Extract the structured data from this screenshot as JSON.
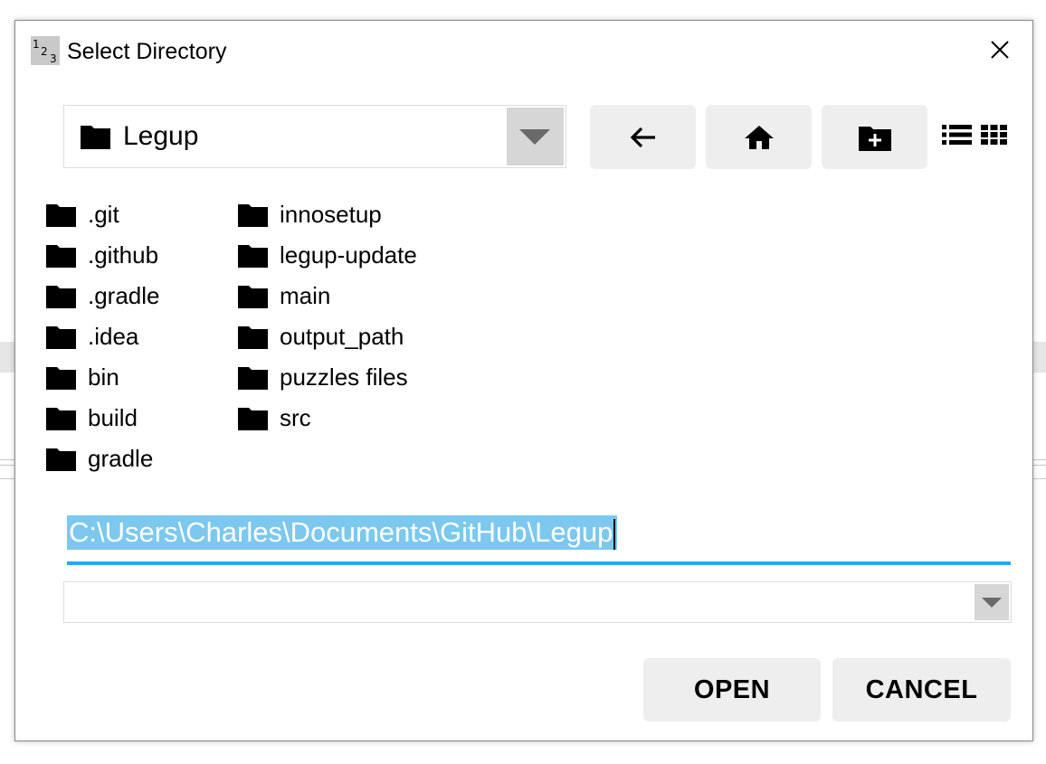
{
  "dialog": {
    "title": "Select Directory",
    "app_icon": "legup-123-icon",
    "close_icon": "close-icon"
  },
  "toolbar": {
    "current_directory": "Legup",
    "back_icon": "arrow-left-icon",
    "home_icon": "home-icon",
    "new_folder_icon": "new-folder-icon",
    "list_view_icon": "list-view-icon",
    "grid_view_icon": "grid-view-icon"
  },
  "folders": [
    ".git",
    ".github",
    ".gradle",
    ".idea",
    "bin",
    "build",
    "gradle",
    "innosetup",
    "legup-update",
    "main",
    "output_path",
    "puzzles files",
    "src"
  ],
  "path_input": {
    "value": "C:\\Users\\Charles\\Documents\\GitHub\\Legup"
  },
  "filter": {
    "value": ""
  },
  "buttons": {
    "open": "OPEN",
    "cancel": "CANCEL"
  },
  "colors": {
    "accent": "#29a9ea",
    "selection": "#7cc8ee",
    "button_bg": "#eeeeee"
  }
}
